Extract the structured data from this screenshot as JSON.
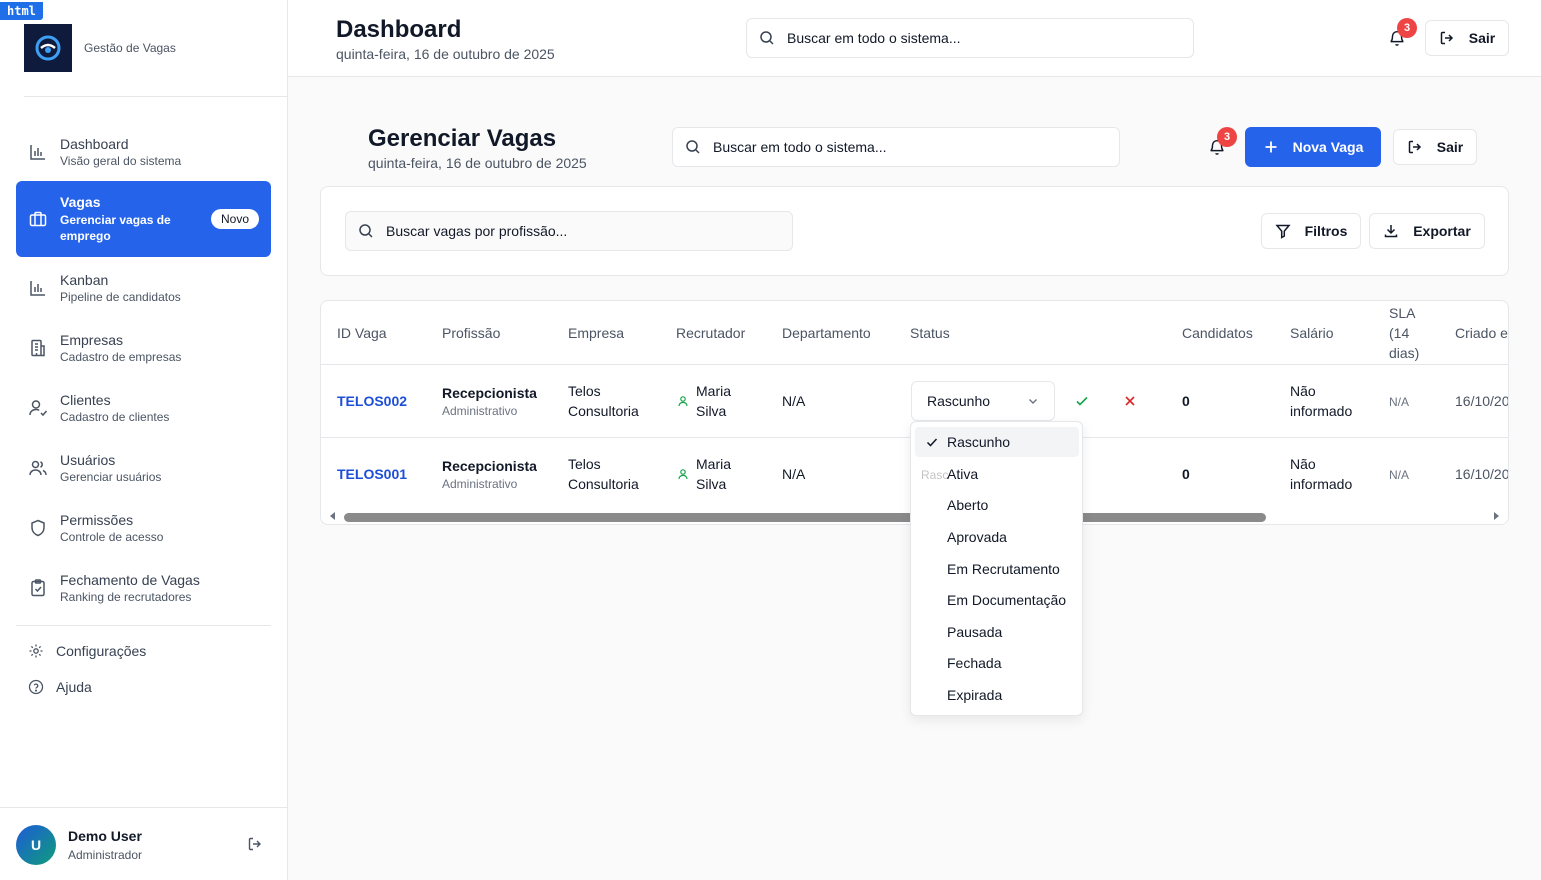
{
  "overlay_tag": "html",
  "brand": {
    "name": "Gestão de Vagas",
    "logo_icon": "globe-logo-icon"
  },
  "sidebar": {
    "items": [
      {
        "title": "Dashboard",
        "subtitle": "Visão geral do sistema",
        "icon": "bar-chart-icon"
      },
      {
        "title": "Vagas",
        "subtitle": "Gerenciar vagas de emprego",
        "icon": "briefcase-icon",
        "badge": "Novo",
        "active": true
      },
      {
        "title": "Kanban",
        "subtitle": "Pipeline de candidatos",
        "icon": "bar-chart-icon"
      },
      {
        "title": "Empresas",
        "subtitle": "Cadastro de empresas",
        "icon": "building-icon"
      },
      {
        "title": "Clientes",
        "subtitle": "Cadastro de clientes",
        "icon": "user-check-icon"
      },
      {
        "title": "Usuários",
        "subtitle": "Gerenciar usuários",
        "icon": "users-icon"
      },
      {
        "title": "Permissões",
        "subtitle": "Controle de acesso",
        "icon": "shield-icon"
      },
      {
        "title": "Fechamento de Vagas",
        "subtitle": "Ranking de recrutadores",
        "icon": "clipboard-check-icon"
      }
    ],
    "footer": {
      "settings": "Configurações",
      "help": "Ajuda"
    },
    "user": {
      "initial": "U",
      "name": "Demo User",
      "role": "Administrador"
    }
  },
  "header": {
    "title": "Dashboard",
    "date": "quinta-feira, 16 de outubro de 2025",
    "search_placeholder": "Buscar em todo o sistema...",
    "notifications": "3",
    "logout": "Sair"
  },
  "page": {
    "title": "Gerenciar Vagas",
    "date": "quinta-feira, 16 de outubro de 2025",
    "search_placeholder": "Buscar em todo o sistema...",
    "notifications": "3",
    "new_button": "Nova Vaga",
    "logout": "Sair"
  },
  "filters": {
    "search_placeholder": "Buscar vagas por profissão...",
    "filters_button": "Filtros",
    "export_button": "Exportar"
  },
  "table": {
    "headers": {
      "id": "ID Vaga",
      "profession": "Profissão",
      "company": "Empresa",
      "recruiter": "Recrutador",
      "department": "Departamento",
      "status": "Status",
      "candidates": "Candidatos",
      "salary": "Salário",
      "sla_1": "SLA",
      "sla_2": "(14",
      "sla_3": "dias)",
      "created": "Criado e"
    },
    "rows": [
      {
        "id": "TELOS002",
        "profession": "Recepcionista",
        "area": "Administrativo",
        "company_1": "Telos",
        "company_2": "Consultoria",
        "recruiter_1": "Maria",
        "recruiter_2": "Silva",
        "department": "N/A",
        "status": "Rascunho",
        "candidates": "0",
        "salary_1": "Não",
        "salary_2": "informado",
        "sla": "N/A",
        "created": "16/10/20"
      },
      {
        "id": "TELOS001",
        "profession": "Recepcionista",
        "area": "Administrativo",
        "company_1": "Telos",
        "company_2": "Consultoria",
        "recruiter_1": "Maria",
        "recruiter_2": "Silva",
        "department": "N/A",
        "status_ghost": "Rasc",
        "candidates": "0",
        "salary_1": "Não",
        "salary_2": "informado",
        "sla": "N/A",
        "created": "16/10/20"
      }
    ]
  },
  "status_dropdown": {
    "selected": "Rascunho",
    "options": [
      "Rascunho",
      "Ativa",
      "Aberto",
      "Aprovada",
      "Em Recrutamento",
      "Em Documentação",
      "Pausada",
      "Fechada",
      "Expirada"
    ]
  },
  "colors": {
    "primary": "#2563eb",
    "badge": "#ef4444",
    "link": "#1d4ed8",
    "success": "#16a34a",
    "danger": "#dc2626"
  }
}
